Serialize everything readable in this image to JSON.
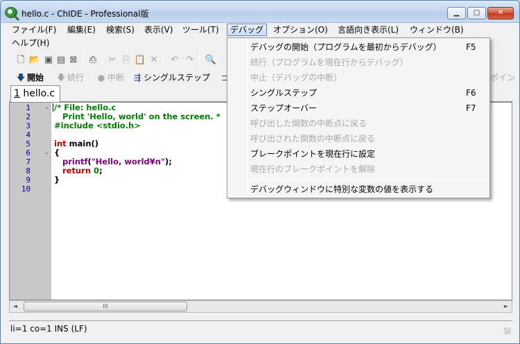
{
  "window": {
    "title": "hello.c - ChIDE - Professional版",
    "controls": {
      "minimize": "▁",
      "maximize": "□",
      "close": "✕"
    }
  },
  "menubar": {
    "items": [
      "ファイル(F)",
      "編集(E)",
      "検索(S)",
      "表示(V)",
      "ツール(T)",
      "デバッグ",
      "オプション(O)",
      "言語向き表示(L)",
      "ウィンドウ(B)",
      "ヘルプ(H)"
    ]
  },
  "toolbar1": {
    "icons": [
      "new-file-icon",
      "open-folder-icon",
      "save-icon",
      "save-all-icon",
      "close-file-icon",
      "print-icon",
      "cut-icon",
      "copy-icon",
      "paste-icon",
      "delete-icon",
      "undo-icon",
      "redo-icon",
      "find-icon"
    ]
  },
  "toolbar2": {
    "start": "開始",
    "continue": "続行",
    "stop": "中断",
    "single_step": "シングルステップ",
    "breakpoint_partial": "ポイン"
  },
  "tabs": [
    {
      "number": "1",
      "name": " hello.c"
    }
  ],
  "editor": {
    "line_numbers": [
      "1",
      "2",
      "3",
      "4",
      "5",
      "6",
      "7",
      "8",
      "9",
      "10"
    ],
    "code": {
      "l1": "/* File: hello.c",
      "l2": "   Print 'Hello, world' on the screen. *",
      "l3": "#include <stdio.h>",
      "l5_kw": "int",
      "l5_rest": " main()",
      "l6": "{",
      "l7_fn": "   printf",
      "l7_p1": "(",
      "l7_str": "\"Hello, world¥n\"",
      "l7_p2": ");",
      "l8_kw": "   return",
      "l8_sp": " ",
      "l8_num": "0",
      "l8_end": ";",
      "l9": "}"
    }
  },
  "hscroll": {
    "left": "◄",
    "thumb": "III",
    "right": "►"
  },
  "statusbar": {
    "text": "li=1 co=1 INS (LF)"
  },
  "debug_menu": {
    "items": [
      {
        "label": "デバッグの開始（プログラムを最初からデバッグ）",
        "shortcut": "F5",
        "enabled": true
      },
      {
        "label": "続行（プログラムを現在行からデバッグ）",
        "shortcut": "",
        "enabled": false
      },
      {
        "label": "中止（デバッグの中断）",
        "shortcut": "",
        "enabled": false
      },
      {
        "label": "シングルステップ",
        "shortcut": "F6",
        "enabled": true
      },
      {
        "label": "ステップオーバー",
        "shortcut": "F7",
        "enabled": true
      },
      {
        "label": "呼び出した関数の中断点に戻る",
        "shortcut": "",
        "enabled": false
      },
      {
        "label": "呼び出された関数の中断点に戻る",
        "shortcut": "",
        "enabled": false
      },
      {
        "label": "ブレークポイントを現在行に設定",
        "shortcut": "",
        "enabled": true
      },
      {
        "label": "現在行のブレークポイントを解除",
        "shortcut": "",
        "enabled": false
      },
      {
        "label": "デバッグウィンドウに特別な変数の値を表示する",
        "shortcut": "",
        "enabled": true
      }
    ]
  },
  "colors": {
    "comment": "#008000",
    "keyword": "#c00000",
    "function": "#800080",
    "disabled": "#a8a8a8"
  }
}
